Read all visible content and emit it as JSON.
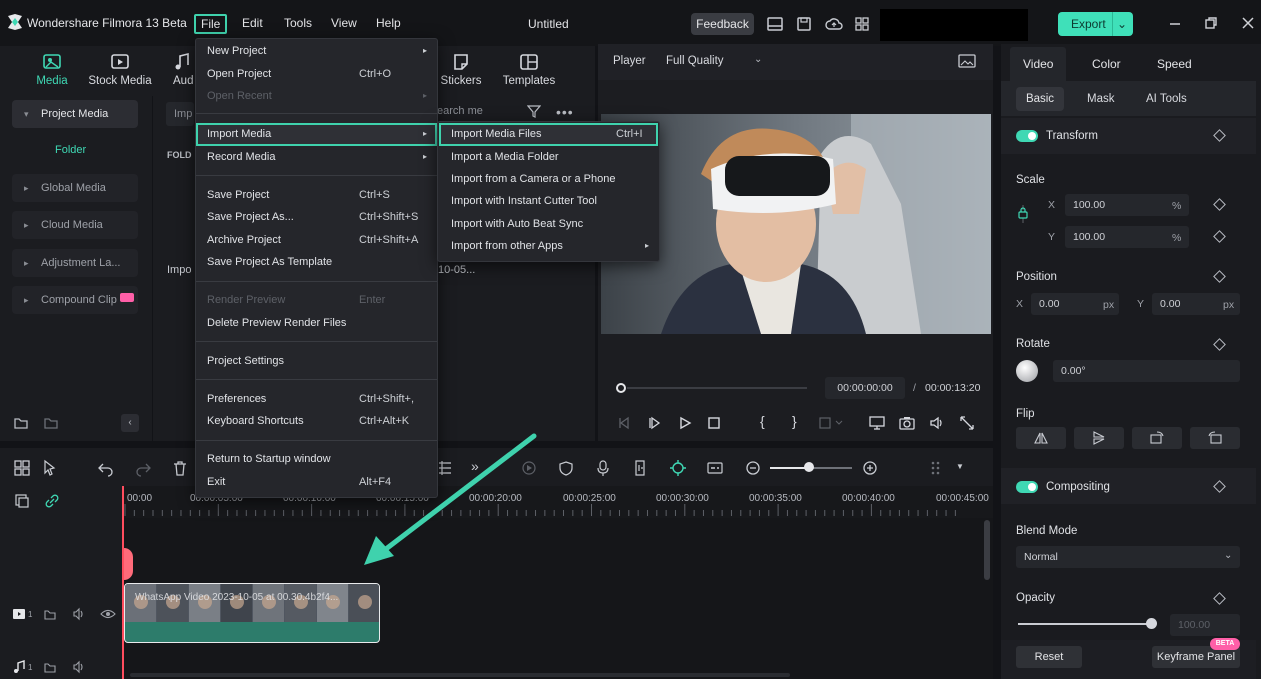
{
  "app": {
    "title": "Wondershare Filmora 13 Beta",
    "document_title": "Untitled"
  },
  "menubar": {
    "file": "File",
    "edit": "Edit",
    "tools": "Tools",
    "view": "View",
    "help": "Help"
  },
  "header": {
    "feedback": "Feedback",
    "export": "Export"
  },
  "media_tabs": [
    {
      "label": "Media",
      "icon": "media-icon"
    },
    {
      "label": "Stock Media",
      "icon": "stock-media-icon"
    },
    {
      "label": "Aud",
      "icon": "audio-icon"
    },
    {
      "label": "Stickers",
      "icon": "stickers-icon"
    },
    {
      "label": "Templates",
      "icon": "templates-icon"
    }
  ],
  "left_panel": {
    "project_media": "Project Media",
    "folder": "Folder",
    "global_media": "Global Media",
    "cloud_media": "Cloud Media",
    "adjustment": "Adjustment La...",
    "compound": "Compound Clip"
  },
  "content_area": {
    "search_partial": "earch me",
    "import_partial": "Imp",
    "folder_partial": "FOLD",
    "import_text_partial": "Impo",
    "date_partial": "10-05..."
  },
  "file_menu": {
    "items": [
      {
        "label": "New Project",
        "shortcut": "",
        "submenu": true,
        "disabled": false
      },
      {
        "label": "Open Project",
        "shortcut": "Ctrl+O",
        "submenu": false,
        "disabled": false
      },
      {
        "label": "Open Recent",
        "shortcut": "",
        "submenu": true,
        "disabled": true
      },
      {
        "label": "Import Media",
        "shortcut": "",
        "submenu": true,
        "disabled": false
      },
      {
        "label": "Record Media",
        "shortcut": "",
        "submenu": true,
        "disabled": false
      },
      {
        "label": "Save Project",
        "shortcut": "Ctrl+S",
        "submenu": false,
        "disabled": false
      },
      {
        "label": "Save Project As...",
        "shortcut": "Ctrl+Shift+S",
        "submenu": false,
        "disabled": false
      },
      {
        "label": "Archive Project",
        "shortcut": "Ctrl+Shift+A",
        "submenu": false,
        "disabled": false
      },
      {
        "label": "Save Project As Template",
        "shortcut": "",
        "submenu": false,
        "disabled": false
      },
      {
        "label": "Render Preview",
        "shortcut": "Enter",
        "submenu": false,
        "disabled": true
      },
      {
        "label": "Delete Preview Render Files",
        "shortcut": "",
        "submenu": false,
        "disabled": false
      },
      {
        "label": "Project Settings",
        "shortcut": "",
        "submenu": false,
        "disabled": false
      },
      {
        "label": "Preferences",
        "shortcut": "Ctrl+Shift+,",
        "submenu": false,
        "disabled": false
      },
      {
        "label": "Keyboard Shortcuts",
        "shortcut": "Ctrl+Alt+K",
        "submenu": false,
        "disabled": false
      },
      {
        "label": "Return to Startup window",
        "shortcut": "",
        "submenu": false,
        "disabled": false
      },
      {
        "label": "Exit",
        "shortcut": "Alt+F4",
        "submenu": false,
        "disabled": false
      }
    ]
  },
  "import_submenu": {
    "items": [
      {
        "label": "Import Media Files",
        "shortcut": "Ctrl+I"
      },
      {
        "label": "Import a Media Folder",
        "shortcut": ""
      },
      {
        "label": "Import from a Camera or a Phone",
        "shortcut": ""
      },
      {
        "label": "Import with Instant Cutter Tool",
        "shortcut": ""
      },
      {
        "label": "Import with Auto Beat Sync",
        "shortcut": ""
      },
      {
        "label": "Import from other Apps",
        "shortcut": ""
      }
    ]
  },
  "player": {
    "label": "Player",
    "quality": "Full Quality",
    "current_time": "00:00:00:00",
    "separator": "/",
    "total_time": "00:00:13:20"
  },
  "right_panel": {
    "tabs": [
      "Video",
      "Color",
      "Speed"
    ],
    "subtabs": [
      "Basic",
      "Mask",
      "AI Tools"
    ],
    "transform": "Transform",
    "scale": "Scale",
    "scale_x_label": "X",
    "scale_x": "100.00",
    "scale_x_unit": "%",
    "scale_y_label": "Y",
    "scale_y": "100.00",
    "scale_y_unit": "%",
    "position": "Position",
    "pos_x_label": "X",
    "pos_x": "0.00",
    "pos_x_unit": "px",
    "pos_y_label": "Y",
    "pos_y": "0.00",
    "pos_y_unit": "px",
    "rotate": "Rotate",
    "rotate_value": "0.00°",
    "flip": "Flip",
    "compositing": "Compositing",
    "blend_mode": "Blend Mode",
    "blend_value": "Normal",
    "opacity": "Opacity",
    "opacity_value": "100.00",
    "opacity_level": 1.0,
    "reset": "Reset",
    "keyframe_panel": "Keyframe Panel",
    "beta": "BETA"
  },
  "timeline": {
    "ruler": [
      "00:00",
      "00:00:05:00",
      "00:00:10:00",
      "00:00:15:00",
      "00:00:20:00",
      "00:00:25:00",
      "00:00:30:00",
      "00:00:35:00",
      "00:00:40:00",
      "00:00:45:00"
    ],
    "clip_label": "WhatsApp Video 2023-10-05 at 00.30.4b2f4...",
    "track1": "1",
    "track2": "1"
  }
}
